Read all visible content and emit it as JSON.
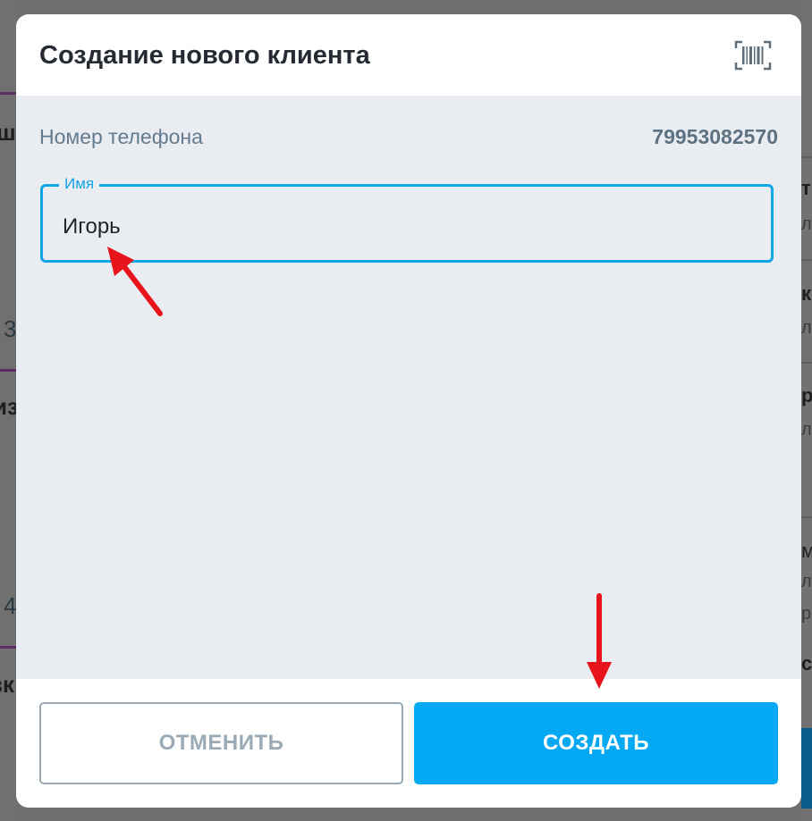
{
  "background": {
    "left_fragments": [
      "ш",
      "3",
      "из",
      "4",
      "зк"
    ],
    "right_fragments": [
      "т",
      "л",
      "к",
      "л",
      "р",
      "л",
      "м",
      "л",
      "р",
      "с"
    ]
  },
  "dialog": {
    "title": "Создание нового клиента",
    "scan_icon": "barcode-scan-icon",
    "phone": {
      "label": "Номер телефона",
      "value": "79953082570"
    },
    "name_field": {
      "label": "Имя",
      "value": "Игорь"
    },
    "buttons": {
      "cancel": "ОТМЕНИТЬ",
      "create": "СОЗДАТЬ"
    }
  },
  "colors": {
    "accent": "#05a8f2",
    "field_border": "#12a6e8",
    "annotation_arrow": "#e8141b"
  }
}
